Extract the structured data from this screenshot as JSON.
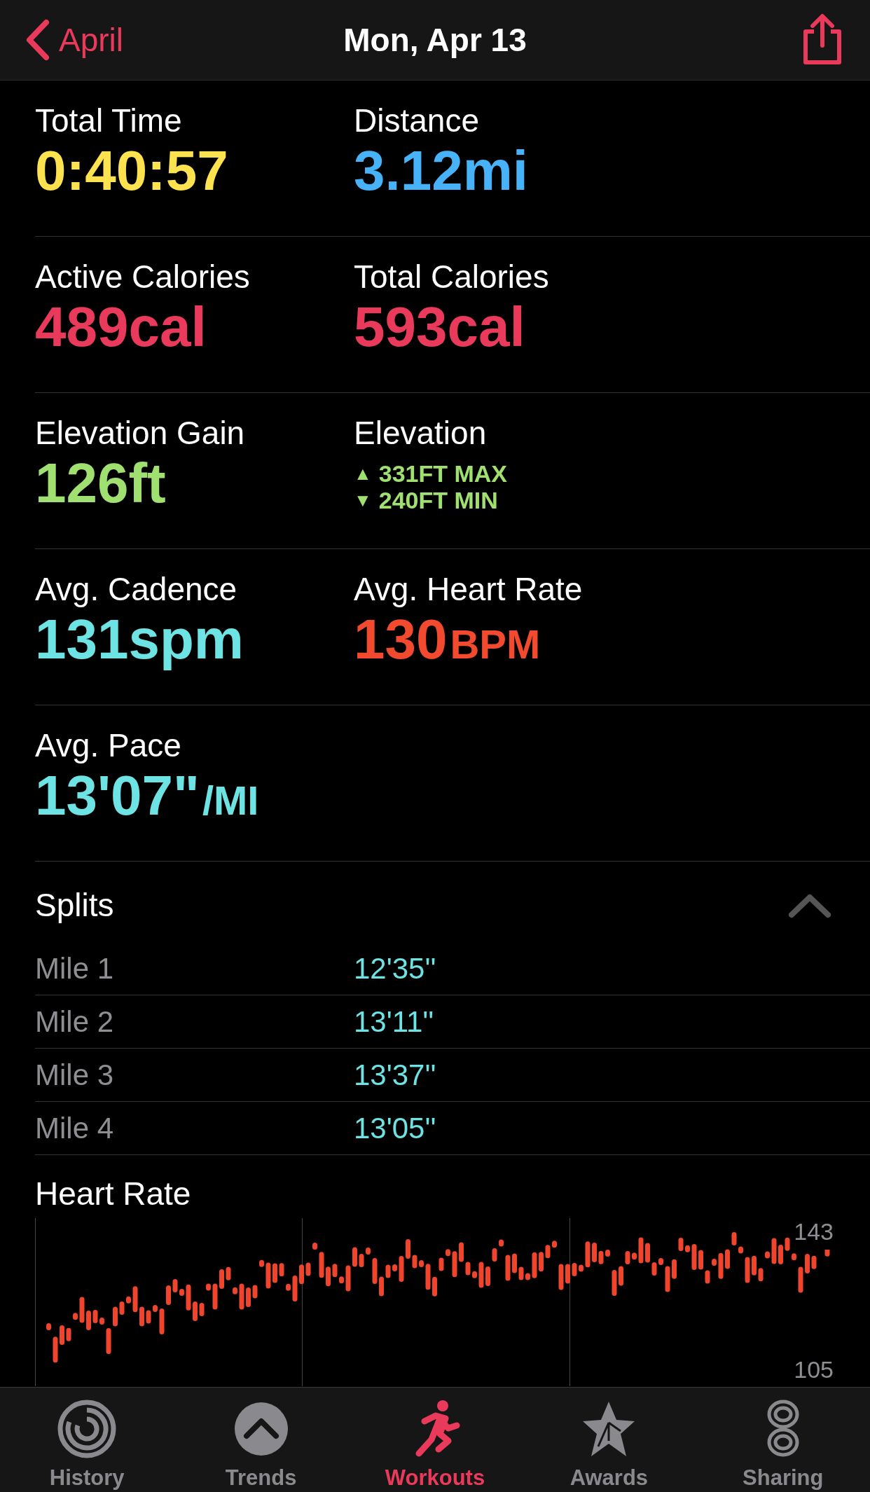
{
  "nav": {
    "back": "April",
    "title": "Mon, Apr 13"
  },
  "metrics": [
    {
      "kind": "value",
      "label": "Total Time",
      "value": "0:40:57",
      "color": "#fde24f"
    },
    {
      "kind": "value",
      "label": "Distance",
      "value": "3.12mi",
      "color": "#47b2f7"
    },
    {
      "kind": "value",
      "label": "Active Calories",
      "value": "489cal",
      "color": "#ea3a5b"
    },
    {
      "kind": "value",
      "label": "Total Calories",
      "value": "593cal",
      "color": "#ea3a5b"
    },
    {
      "kind": "value",
      "label": "Elevation Gain",
      "value": "126ft",
      "color": "#a0e070"
    },
    {
      "kind": "range",
      "label": "Elevation",
      "color": "#a0e070",
      "lines": [
        {
          "arrow": "▲",
          "text": "331FT MAX"
        },
        {
          "arrow": "▼",
          "text": "240FT MIN"
        }
      ]
    },
    {
      "kind": "value",
      "label": "Avg. Cadence",
      "value": "131spm",
      "color": "#6ee3e3"
    },
    {
      "kind": "value",
      "label": "Avg. Heart Rate",
      "value": "130",
      "unit": "BPM",
      "color": "#f24a2e"
    },
    {
      "kind": "value",
      "label": "Avg. Pace",
      "value": "13'07\"",
      "unit": "/MI",
      "color": "#6ee3e3"
    }
  ],
  "splits": {
    "title": "Splits",
    "expanded": true,
    "rows": [
      {
        "label": "Mile 1",
        "value": "12'35''"
      },
      {
        "label": "Mile 2",
        "value": "13'11''"
      },
      {
        "label": "Mile 3",
        "value": "13'37''"
      },
      {
        "label": "Mile 4",
        "value": "13'05''"
      }
    ]
  },
  "heart_rate": {
    "title": "Heart Rate",
    "y_labels": [
      "143",
      "105"
    ]
  },
  "tabs": [
    {
      "label": "History",
      "selected": false
    },
    {
      "label": "Trends",
      "selected": false
    },
    {
      "label": "Workouts",
      "selected": true
    },
    {
      "label": "Awards",
      "selected": false
    },
    {
      "label": "Sharing",
      "selected": false
    }
  ]
}
